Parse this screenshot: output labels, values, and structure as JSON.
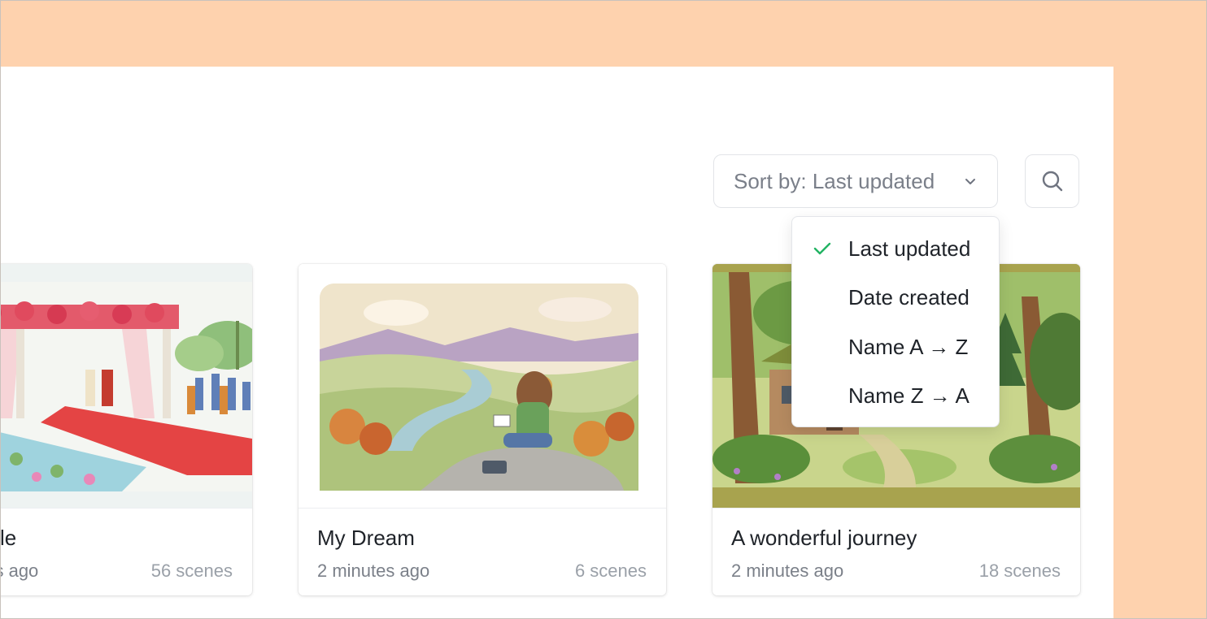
{
  "toolbar": {
    "sort_label": "Sort by: Last updated",
    "search_icon": "search-icon",
    "chevron_icon": "chevron-down-icon"
  },
  "sort_menu": {
    "selected": "Last updated",
    "items": [
      {
        "label": "Last updated",
        "checked": true
      },
      {
        "label": "Date created",
        "checked": false
      },
      {
        "label": "Name A → Z",
        "checked": false
      },
      {
        "label": "Name Z → A",
        "checked": false
      }
    ]
  },
  "projects": [
    {
      "title": "le",
      "updated": "nds ago",
      "scenes": "56 scenes"
    },
    {
      "title": "My Dream",
      "updated": "2 minutes ago",
      "scenes": "6 scenes"
    },
    {
      "title": "A wonderful journey",
      "updated": "2 minutes ago",
      "scenes": "18 scenes"
    }
  ],
  "colors": {
    "background": "#fed2ae",
    "check": "#22b363",
    "forest_frame": "#a8a34e"
  }
}
